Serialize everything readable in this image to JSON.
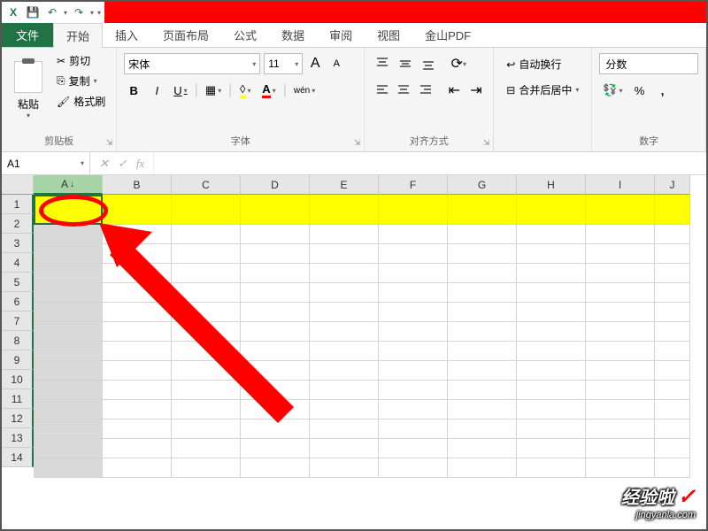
{
  "qat": {
    "save": "💾",
    "undo": "↶",
    "redo": "↷"
  },
  "tabs": {
    "file": "文件",
    "items": [
      "开始",
      "插入",
      "页面布局",
      "公式",
      "数据",
      "审阅",
      "视图",
      "金山PDF"
    ],
    "active": 0
  },
  "clipboard": {
    "paste": "粘贴",
    "cut": "剪切",
    "copy": "复制",
    "format_painter": "格式刷",
    "group_label": "剪贴板"
  },
  "font": {
    "name": "宋体",
    "size": "11",
    "increase": "A",
    "decrease": "A",
    "bold": "B",
    "italic": "I",
    "underline": "U",
    "wen": "wén",
    "group_label": "字体"
  },
  "alignment": {
    "wrap_text": "自动换行",
    "merge_center": "合并后居中",
    "group_label": "对齐方式"
  },
  "number": {
    "format": "分数",
    "percent": "%",
    "comma": ",",
    "group_label": "数字"
  },
  "name_box": "A1",
  "fx": "fx",
  "columns": [
    "A",
    "B",
    "C",
    "D",
    "E",
    "F",
    "G",
    "H",
    "I",
    "J"
  ],
  "rows": [
    "1",
    "2",
    "3",
    "4",
    "5",
    "6",
    "7",
    "8",
    "9",
    "10",
    "11",
    "12",
    "13",
    "14"
  ],
  "watermark": {
    "main": "经验啦",
    "sub": "jingyanla.com"
  }
}
